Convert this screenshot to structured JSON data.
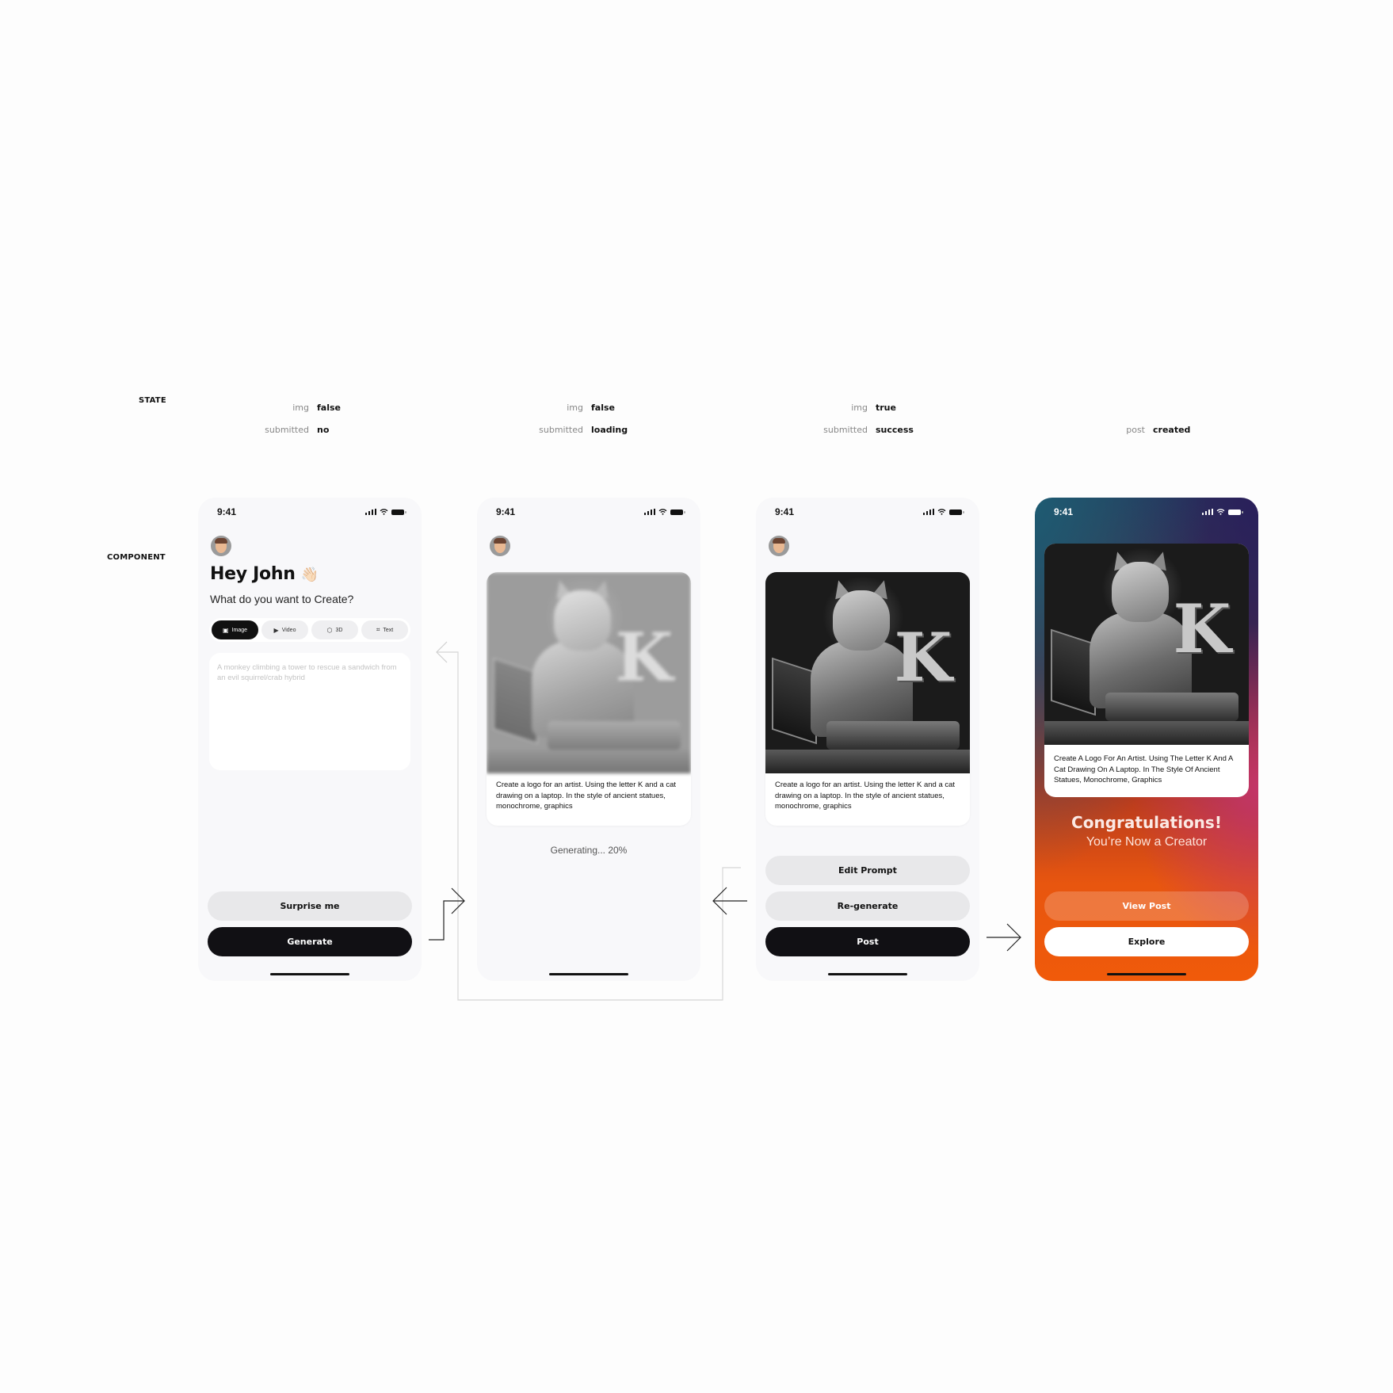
{
  "labels": {
    "state": "STATE",
    "component": "COMPONENT"
  },
  "states": [
    {
      "rows": [
        {
          "key": "img",
          "value": "false"
        },
        {
          "key": "submitted",
          "value": "no"
        }
      ]
    },
    {
      "rows": [
        {
          "key": "img",
          "value": "false"
        },
        {
          "key": "submitted",
          "value": "loading"
        }
      ]
    },
    {
      "rows": [
        {
          "key": "img",
          "value": "true"
        },
        {
          "key": "submitted",
          "value": "success"
        }
      ]
    },
    {
      "rows": [
        {
          "key": "post",
          "value": "created"
        }
      ]
    }
  ],
  "status_bar": {
    "time": "9:41",
    "icons": [
      "signal-icon",
      "wifi-icon",
      "battery-icon"
    ]
  },
  "screen1": {
    "greeting": "Hey John",
    "greeting_emoji": "👋🏻",
    "subtitle": "What do you want to Create?",
    "tabs": [
      {
        "label": "Image",
        "icon": "image-icon",
        "glyph": "▣",
        "active": true
      },
      {
        "label": "Video",
        "icon": "video-icon",
        "glyph": "▶",
        "active": false
      },
      {
        "label": "3D",
        "icon": "cube-icon",
        "glyph": "⬡",
        "active": false
      },
      {
        "label": "Text",
        "icon": "text-scan-icon",
        "glyph": "⌗",
        "active": false
      }
    ],
    "prompt_placeholder": "A monkey climbing a tower to rescue a sandwich from an evil squirrel/crab hybrid",
    "prompt_value": "",
    "surprise_label": "Surprise me",
    "generate_label": "Generate"
  },
  "screen2": {
    "caption": "Create a logo for an artist. Using the letter K and a cat drawing on a laptop. In the style of ancient statues, monochrome, graphics",
    "progress_text": "Generating... 20%",
    "progress_percent": 20
  },
  "screen3": {
    "caption": "Create a logo for an artist. Using the letter K and a cat drawing on a laptop. In the style of ancient statues, monochrome, graphics",
    "edit_label": "Edit Prompt",
    "regenerate_label": "Re-generate",
    "post_label": "Post"
  },
  "screen4": {
    "caption": "Create A Logo For An Artist. Using The Letter K And A Cat Drawing On A Laptop. In The Style Of Ancient Statues, Monochrome, Graphics",
    "title": "Congratulations!",
    "subtitle": "You’re Now a Creator",
    "view_post_label": "View Post",
    "explore_label": "Explore"
  },
  "artwork": {
    "letter": "K",
    "subject": "cat statue drawing on a laptop"
  },
  "colors": {
    "dark_button": "#111014",
    "light_button": "#e8e8ea",
    "accent_orange": "#f05a0a",
    "accent_pink": "#c33568",
    "phone_bg": "#f8f8fa"
  }
}
